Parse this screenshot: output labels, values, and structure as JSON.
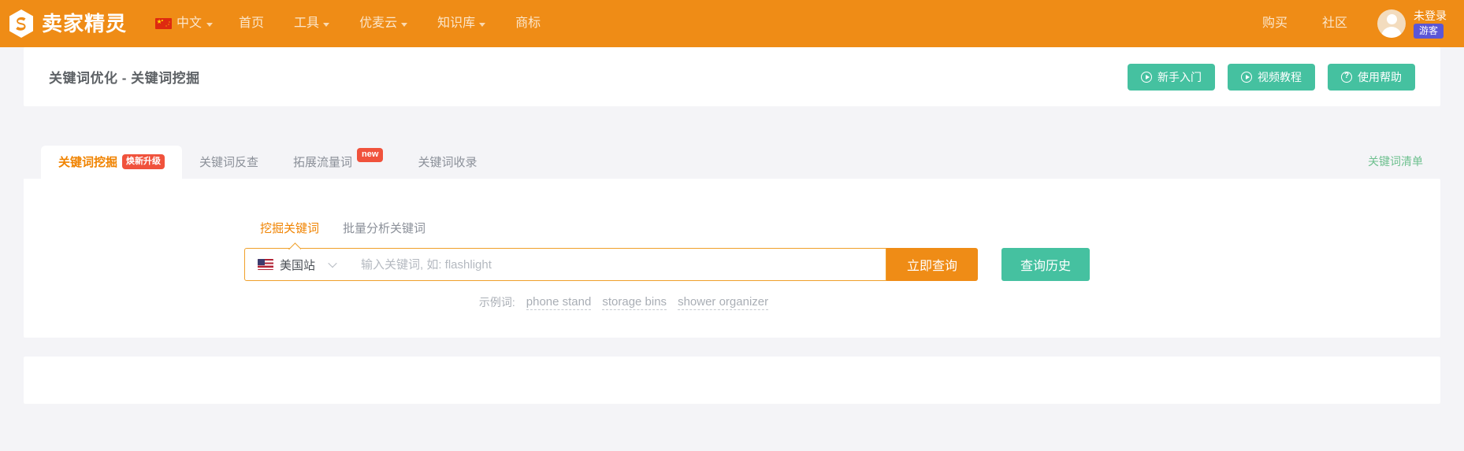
{
  "topnav": {
    "logo_text": "卖家精灵",
    "logo_icon": "seller-sprite-s-logo",
    "lang": {
      "label": "中文",
      "flag": "cn-flag-icon"
    },
    "items": [
      {
        "label": "首页",
        "has_caret": false
      },
      {
        "label": "工具",
        "has_caret": true
      },
      {
        "label": "优麦云",
        "has_caret": true
      },
      {
        "label": "知识库",
        "has_caret": true
      },
      {
        "label": "商标",
        "has_caret": false
      }
    ],
    "right_items": [
      {
        "label": "购买"
      },
      {
        "label": "社区"
      }
    ],
    "user": {
      "name": "未登录",
      "badge": "游客",
      "avatar_icon": "user-avatar-icon"
    },
    "bg_color": "#ef8c16"
  },
  "header": {
    "title": "关键词优化 - 关键词挖掘",
    "actions": [
      {
        "label": "新手入门",
        "icon": "play-circle-icon"
      },
      {
        "label": "视频教程",
        "icon": "play-circle-icon"
      },
      {
        "label": "使用帮助",
        "icon": "question-circle-icon"
      }
    ],
    "action_color": "#45c1a0"
  },
  "tabs": {
    "items": [
      {
        "label": "关键词挖掘",
        "badge": "焕新升级",
        "badge_type": "red",
        "active": true
      },
      {
        "label": "关键词反查",
        "badge": "",
        "badge_type": "",
        "active": false
      },
      {
        "label": "拓展流量词",
        "badge": "new",
        "badge_type": "new",
        "active": false
      },
      {
        "label": "关键词收录",
        "badge": "",
        "badge_type": "",
        "active": false
      }
    ],
    "right_link": "关键词清单",
    "active_color": "#f08300",
    "link_color": "#6ec08f"
  },
  "search": {
    "subtabs": [
      {
        "label": "挖掘关键词",
        "active": true
      },
      {
        "label": "批量分析关键词",
        "active": false
      }
    ],
    "marketplace": {
      "label": "美国站",
      "flag": "us-flag-icon"
    },
    "input_value": "",
    "input_placeholder": "输入关键词, 如: flashlight",
    "submit_label": "立即查询",
    "history_label": "查询历史",
    "examples_label": "示例词:",
    "examples": [
      "phone stand",
      "storage bins",
      "shower organizer"
    ],
    "border_color": "#f0a02a",
    "submit_color": "#ef8c16",
    "history_color": "#45c1a0"
  }
}
